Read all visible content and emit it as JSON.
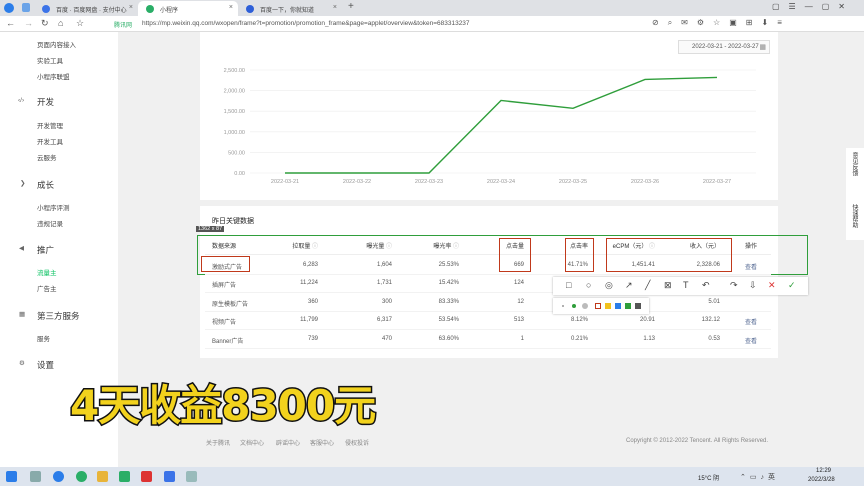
{
  "browser": {
    "tabs": [
      {
        "title": "百度 · 百度网盘 · 支付中心"
      },
      {
        "title": "小程序"
      },
      {
        "title": "百度一下，你就知道"
      }
    ],
    "url": "https://mp.weixin.qq.com/wxopen/frame?t=promotion/promotion_frame&page=applet/overview&token=683313237",
    "security_label": "腾讯网"
  },
  "sidebar": {
    "items": [
      {
        "label": "页面内容接入"
      },
      {
        "label": "实验工具"
      },
      {
        "label": "小程序联盟"
      },
      {
        "label": "开发"
      },
      {
        "label": "开发管理"
      },
      {
        "label": "开发工具"
      },
      {
        "label": "云服务"
      },
      {
        "label": "成长"
      },
      {
        "label": "小程序评测"
      },
      {
        "label": "违规记录"
      },
      {
        "label": "推广"
      },
      {
        "label": "流量主"
      },
      {
        "label": "广告主"
      },
      {
        "label": "第三方服务"
      },
      {
        "label": "服务"
      },
      {
        "label": "设置"
      }
    ]
  },
  "date_range": "2022-03-21 - 2022-03-27",
  "chart_data": {
    "type": "line",
    "x": [
      "2022-03-21",
      "2022-03-22",
      "2022-03-23",
      "2022-03-24",
      "2022-03-25",
      "2022-03-26",
      "2022-03-27"
    ],
    "y_ticks": [
      "2,500.00",
      "2,000.00",
      "1,500.00",
      "1,000.00",
      "500.00",
      "0.00"
    ],
    "ylim": [
      0,
      2500
    ],
    "series": [
      {
        "values": [
          0,
          0,
          0,
          1760,
          1570,
          2270,
          2320
        ],
        "color": "#2f9e3b"
      }
    ],
    "grid": true
  },
  "table": {
    "title": "昨日关键数据",
    "selection_size": "1362 x 87",
    "headers": [
      "数据来源",
      "拉取量",
      "曝光量",
      "曝光率",
      "点击量",
      "点击率",
      "eCPM（元）",
      "收入（元）",
      "操作"
    ],
    "rows": [
      [
        "激励式广告",
        "6,283",
        "1,604",
        "25.53%",
        "669",
        "41.71%",
        "1,451.41",
        "2,328.06",
        "查看"
      ],
      [
        "插屏广告",
        "11,224",
        "1,731",
        "15.42%",
        "124",
        "",
        "",
        "",
        ""
      ],
      [
        "原生模板广告",
        "360",
        "300",
        "83.33%",
        "12",
        "",
        "",
        "5.01",
        ""
      ],
      [
        "视频广告",
        "11,799",
        "6,317",
        "53.54%",
        "513",
        "8.12%",
        "20.91",
        "132.12",
        "查看"
      ],
      [
        "Banner广告",
        "739",
        "470",
        "63.60%",
        "1",
        "0.21%",
        "1.13",
        "0.53",
        "查看"
      ]
    ]
  },
  "overlay_text": "4天收益8300元",
  "footer": {
    "links": [
      "关于腾讯",
      "文档中心",
      "辟谣中心",
      "客服中心",
      "侵权投诉"
    ],
    "copyright": "Copyright © 2012-2022 Tencent. All Rights Reserved."
  },
  "right_float": [
    "意见反馈",
    "快速帮助"
  ],
  "taskbar": {
    "weather": "15°C 阴",
    "time": "12:29",
    "date": "2022/3/28"
  }
}
